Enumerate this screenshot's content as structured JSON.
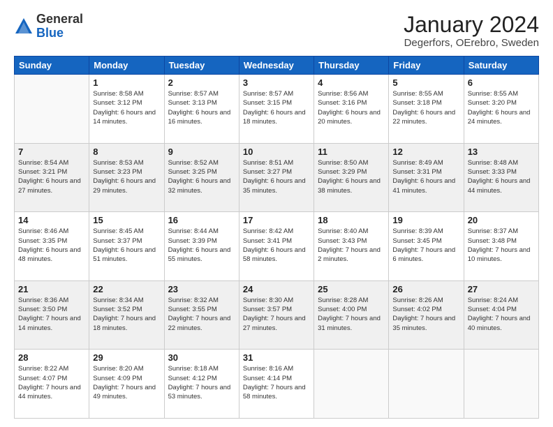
{
  "header": {
    "logo": {
      "general": "General",
      "blue": "Blue"
    },
    "title": "January 2024",
    "subtitle": "Degerfors, OErebro, Sweden"
  },
  "weekdays": [
    "Sunday",
    "Monday",
    "Tuesday",
    "Wednesday",
    "Thursday",
    "Friday",
    "Saturday"
  ],
  "weeks": [
    [
      {
        "day": "",
        "sunrise": "",
        "sunset": "",
        "daylight": ""
      },
      {
        "day": "1",
        "sunrise": "Sunrise: 8:58 AM",
        "sunset": "Sunset: 3:12 PM",
        "daylight": "Daylight: 6 hours and 14 minutes."
      },
      {
        "day": "2",
        "sunrise": "Sunrise: 8:57 AM",
        "sunset": "Sunset: 3:13 PM",
        "daylight": "Daylight: 6 hours and 16 minutes."
      },
      {
        "day": "3",
        "sunrise": "Sunrise: 8:57 AM",
        "sunset": "Sunset: 3:15 PM",
        "daylight": "Daylight: 6 hours and 18 minutes."
      },
      {
        "day": "4",
        "sunrise": "Sunrise: 8:56 AM",
        "sunset": "Sunset: 3:16 PM",
        "daylight": "Daylight: 6 hours and 20 minutes."
      },
      {
        "day": "5",
        "sunrise": "Sunrise: 8:55 AM",
        "sunset": "Sunset: 3:18 PM",
        "daylight": "Daylight: 6 hours and 22 minutes."
      },
      {
        "day": "6",
        "sunrise": "Sunrise: 8:55 AM",
        "sunset": "Sunset: 3:20 PM",
        "daylight": "Daylight: 6 hours and 24 minutes."
      }
    ],
    [
      {
        "day": "7",
        "sunrise": "Sunrise: 8:54 AM",
        "sunset": "Sunset: 3:21 PM",
        "daylight": "Daylight: 6 hours and 27 minutes."
      },
      {
        "day": "8",
        "sunrise": "Sunrise: 8:53 AM",
        "sunset": "Sunset: 3:23 PM",
        "daylight": "Daylight: 6 hours and 29 minutes."
      },
      {
        "day": "9",
        "sunrise": "Sunrise: 8:52 AM",
        "sunset": "Sunset: 3:25 PM",
        "daylight": "Daylight: 6 hours and 32 minutes."
      },
      {
        "day": "10",
        "sunrise": "Sunrise: 8:51 AM",
        "sunset": "Sunset: 3:27 PM",
        "daylight": "Daylight: 6 hours and 35 minutes."
      },
      {
        "day": "11",
        "sunrise": "Sunrise: 8:50 AM",
        "sunset": "Sunset: 3:29 PM",
        "daylight": "Daylight: 6 hours and 38 minutes."
      },
      {
        "day": "12",
        "sunrise": "Sunrise: 8:49 AM",
        "sunset": "Sunset: 3:31 PM",
        "daylight": "Daylight: 6 hours and 41 minutes."
      },
      {
        "day": "13",
        "sunrise": "Sunrise: 8:48 AM",
        "sunset": "Sunset: 3:33 PM",
        "daylight": "Daylight: 6 hours and 44 minutes."
      }
    ],
    [
      {
        "day": "14",
        "sunrise": "Sunrise: 8:46 AM",
        "sunset": "Sunset: 3:35 PM",
        "daylight": "Daylight: 6 hours and 48 minutes."
      },
      {
        "day": "15",
        "sunrise": "Sunrise: 8:45 AM",
        "sunset": "Sunset: 3:37 PM",
        "daylight": "Daylight: 6 hours and 51 minutes."
      },
      {
        "day": "16",
        "sunrise": "Sunrise: 8:44 AM",
        "sunset": "Sunset: 3:39 PM",
        "daylight": "Daylight: 6 hours and 55 minutes."
      },
      {
        "day": "17",
        "sunrise": "Sunrise: 8:42 AM",
        "sunset": "Sunset: 3:41 PM",
        "daylight": "Daylight: 6 hours and 58 minutes."
      },
      {
        "day": "18",
        "sunrise": "Sunrise: 8:40 AM",
        "sunset": "Sunset: 3:43 PM",
        "daylight": "Daylight: 7 hours and 2 minutes."
      },
      {
        "day": "19",
        "sunrise": "Sunrise: 8:39 AM",
        "sunset": "Sunset: 3:45 PM",
        "daylight": "Daylight: 7 hours and 6 minutes."
      },
      {
        "day": "20",
        "sunrise": "Sunrise: 8:37 AM",
        "sunset": "Sunset: 3:48 PM",
        "daylight": "Daylight: 7 hours and 10 minutes."
      }
    ],
    [
      {
        "day": "21",
        "sunrise": "Sunrise: 8:36 AM",
        "sunset": "Sunset: 3:50 PM",
        "daylight": "Daylight: 7 hours and 14 minutes."
      },
      {
        "day": "22",
        "sunrise": "Sunrise: 8:34 AM",
        "sunset": "Sunset: 3:52 PM",
        "daylight": "Daylight: 7 hours and 18 minutes."
      },
      {
        "day": "23",
        "sunrise": "Sunrise: 8:32 AM",
        "sunset": "Sunset: 3:55 PM",
        "daylight": "Daylight: 7 hours and 22 minutes."
      },
      {
        "day": "24",
        "sunrise": "Sunrise: 8:30 AM",
        "sunset": "Sunset: 3:57 PM",
        "daylight": "Daylight: 7 hours and 27 minutes."
      },
      {
        "day": "25",
        "sunrise": "Sunrise: 8:28 AM",
        "sunset": "Sunset: 4:00 PM",
        "daylight": "Daylight: 7 hours and 31 minutes."
      },
      {
        "day": "26",
        "sunrise": "Sunrise: 8:26 AM",
        "sunset": "Sunset: 4:02 PM",
        "daylight": "Daylight: 7 hours and 35 minutes."
      },
      {
        "day": "27",
        "sunrise": "Sunrise: 8:24 AM",
        "sunset": "Sunset: 4:04 PM",
        "daylight": "Daylight: 7 hours and 40 minutes."
      }
    ],
    [
      {
        "day": "28",
        "sunrise": "Sunrise: 8:22 AM",
        "sunset": "Sunset: 4:07 PM",
        "daylight": "Daylight: 7 hours and 44 minutes."
      },
      {
        "day": "29",
        "sunrise": "Sunrise: 8:20 AM",
        "sunset": "Sunset: 4:09 PM",
        "daylight": "Daylight: 7 hours and 49 minutes."
      },
      {
        "day": "30",
        "sunrise": "Sunrise: 8:18 AM",
        "sunset": "Sunset: 4:12 PM",
        "daylight": "Daylight: 7 hours and 53 minutes."
      },
      {
        "day": "31",
        "sunrise": "Sunrise: 8:16 AM",
        "sunset": "Sunset: 4:14 PM",
        "daylight": "Daylight: 7 hours and 58 minutes."
      },
      {
        "day": "",
        "sunrise": "",
        "sunset": "",
        "daylight": ""
      },
      {
        "day": "",
        "sunrise": "",
        "sunset": "",
        "daylight": ""
      },
      {
        "day": "",
        "sunrise": "",
        "sunset": "",
        "daylight": ""
      }
    ]
  ]
}
